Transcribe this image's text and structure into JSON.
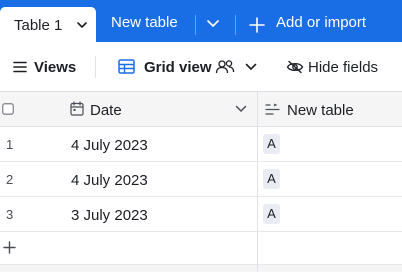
{
  "tabs": {
    "active_label": "Table 1",
    "second_label": "New table",
    "add_label": "Add or import"
  },
  "viewbar": {
    "views_label": "Views",
    "grid_label": "Grid view",
    "hide_fields_label": "Hide fields"
  },
  "grid": {
    "columns": [
      {
        "label": "Date",
        "icon": "calendar-icon"
      },
      {
        "label": "New table",
        "icon": "link-field-icon"
      }
    ],
    "rows": [
      {
        "num": "1",
        "date": "4 July 2023",
        "link": "A"
      },
      {
        "num": "2",
        "date": "4 July 2023",
        "link": "A"
      },
      {
        "num": "3",
        "date": "3 July 2023",
        "link": "A"
      }
    ]
  },
  "colors": {
    "accent": "#1a6ee5",
    "header_bg": "#f5f5f5",
    "chip_bg": "#e9ecf2"
  }
}
